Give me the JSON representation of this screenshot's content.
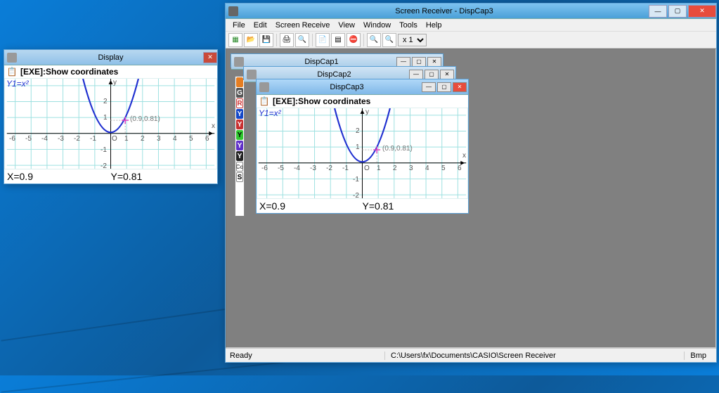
{
  "main_window": {
    "title": "Screen Receiver - DispCap3",
    "menus": [
      "File",
      "Edit",
      "Screen Receive",
      "View",
      "Window",
      "Tools",
      "Help"
    ],
    "toolbar_icons": [
      "new-icon",
      "open-icon",
      "save-icon",
      "print-icon",
      "print-preview-icon",
      "copy-icon",
      "capture-icon",
      "stop-icon",
      "zoom-out-icon",
      "zoom-in-icon"
    ],
    "zoom_value": "x 1",
    "status_left": "Ready",
    "status_path": "C:\\Users\\fx\\Documents\\CASIO\\Screen Receiver",
    "status_right": "Bmp"
  },
  "mdi_children": [
    {
      "title": "DispCap1"
    },
    {
      "title": "DispCap2"
    },
    {
      "title": "DispCap3"
    }
  ],
  "display_window": {
    "title": "Display"
  },
  "graph": {
    "header": "[EXE]:Show coordinates",
    "function_label": "Y1=x²",
    "y_axis_label": "y",
    "x_axis_label": "x",
    "origin_label": "O",
    "cursor_point_label": "(0.9,0.81)",
    "x_readout": "X=0.9",
    "y_readout": "Y=0.81",
    "x_ticks": [
      "-6",
      "-5",
      "-4",
      "-3",
      "-2",
      "-1",
      "1",
      "2",
      "3",
      "4",
      "5",
      "6"
    ],
    "y_ticks_pos": [
      "1",
      "2"
    ],
    "y_ticks_neg": [
      "-1",
      "-2"
    ]
  },
  "chart_data": {
    "type": "line",
    "title": "Y1 = x²",
    "xlabel": "x",
    "ylabel": "y",
    "xlim": [
      -6.3,
      6.3
    ],
    "ylim": [
      -2.6,
      3.1
    ],
    "x_ticks": [
      -6,
      -5,
      -4,
      -3,
      -2,
      -1,
      0,
      1,
      2,
      3,
      4,
      5,
      6
    ],
    "y_ticks": [
      -2,
      -1,
      0,
      1,
      2
    ],
    "series": [
      {
        "name": "Y1=x²",
        "x": [
          -1.8,
          -1.5,
          -1.2,
          -0.9,
          -0.6,
          -0.3,
          0,
          0.3,
          0.6,
          0.9,
          1.2,
          1.5,
          1.8
        ],
        "y": [
          3.24,
          2.25,
          1.44,
          0.81,
          0.36,
          0.09,
          0,
          0.09,
          0.36,
          0.81,
          1.44,
          2.25,
          3.24
        ]
      }
    ],
    "cursor": {
      "x": 0.9,
      "y": 0.81
    }
  },
  "side_labels": [
    "G",
    "R",
    "Y",
    "Y",
    "Y",
    "Y",
    "Y",
    "Co",
    "S"
  ]
}
